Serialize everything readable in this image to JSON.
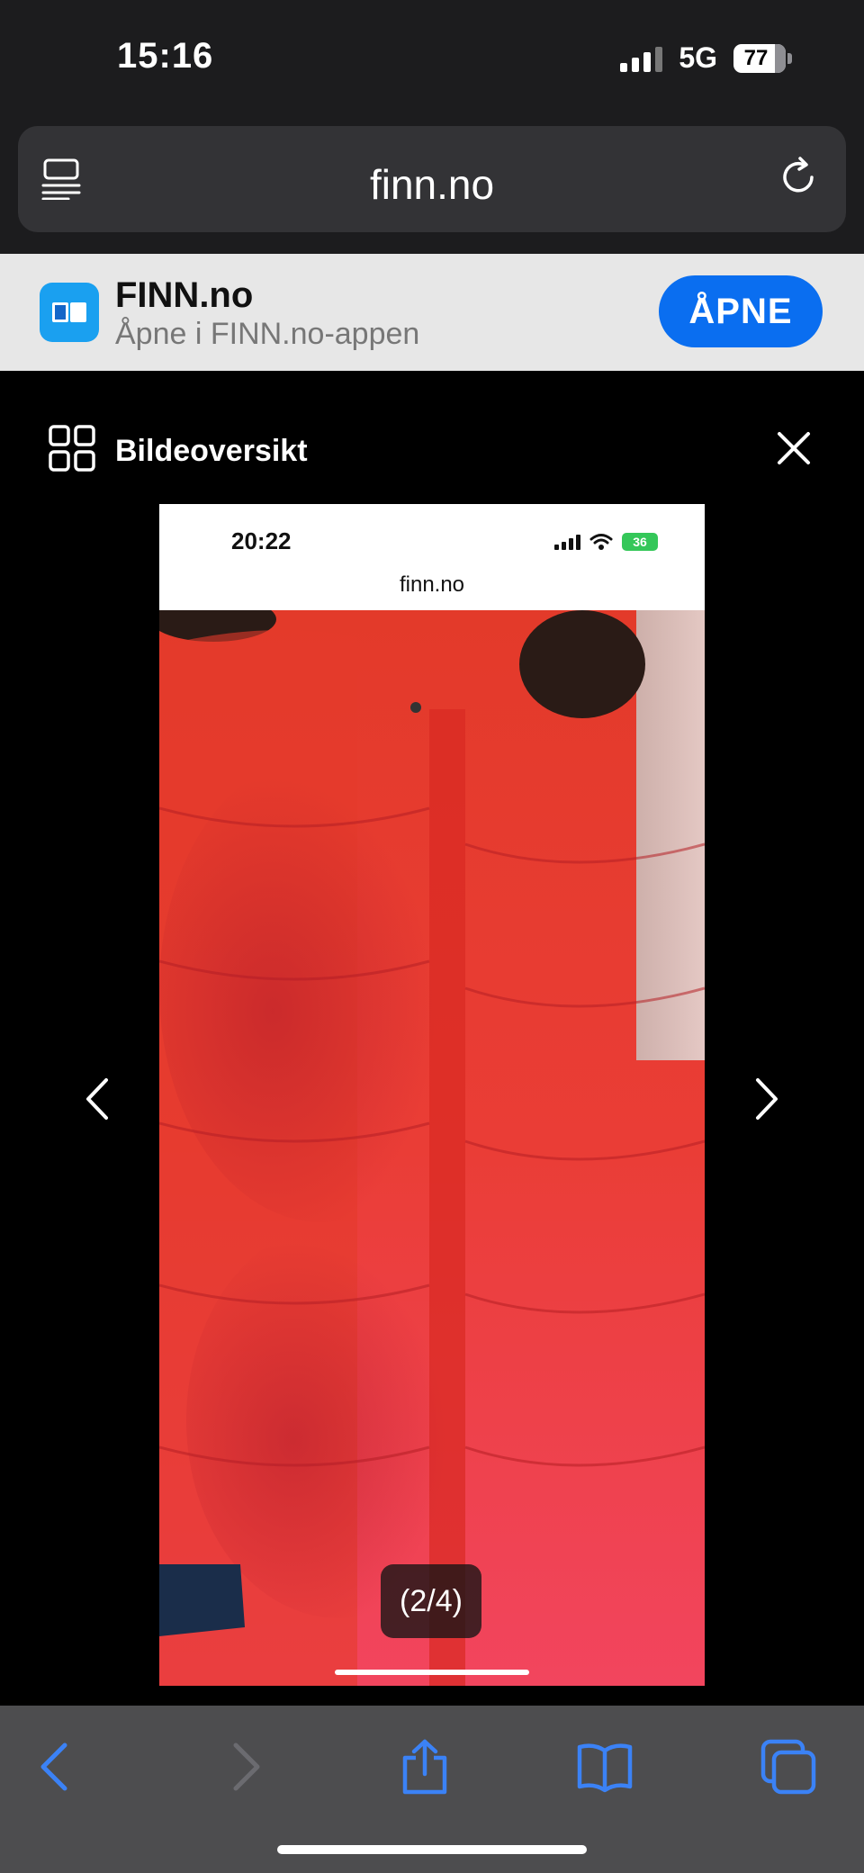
{
  "status_bar": {
    "time": "15:16",
    "network": "5G",
    "battery": "77"
  },
  "url_bar": {
    "domain": "finn.no"
  },
  "app_banner": {
    "name": "FINN.no",
    "subtitle": "Åpne i FINN.no-appen",
    "open_label": "ÅPNE"
  },
  "viewer": {
    "title": "Bildeoversikt",
    "counter": "(2/4)"
  },
  "inner_screenshot": {
    "time": "20:22",
    "battery": "36",
    "domain": "finn.no"
  },
  "colors": {
    "accent": "#0a6ef0",
    "toolbar_icon": "#3b82f6",
    "jacket": "#e8352a"
  },
  "icons": {
    "reader": "reader-mode-icon",
    "reload": "reload-icon",
    "grid": "grid-icon",
    "close": "close-icon",
    "prev": "chevron-left-icon",
    "next": "chevron-right-icon",
    "back": "back-icon",
    "forward": "forward-icon",
    "share": "share-icon",
    "bookmarks": "book-icon",
    "tabs": "tabs-icon"
  }
}
